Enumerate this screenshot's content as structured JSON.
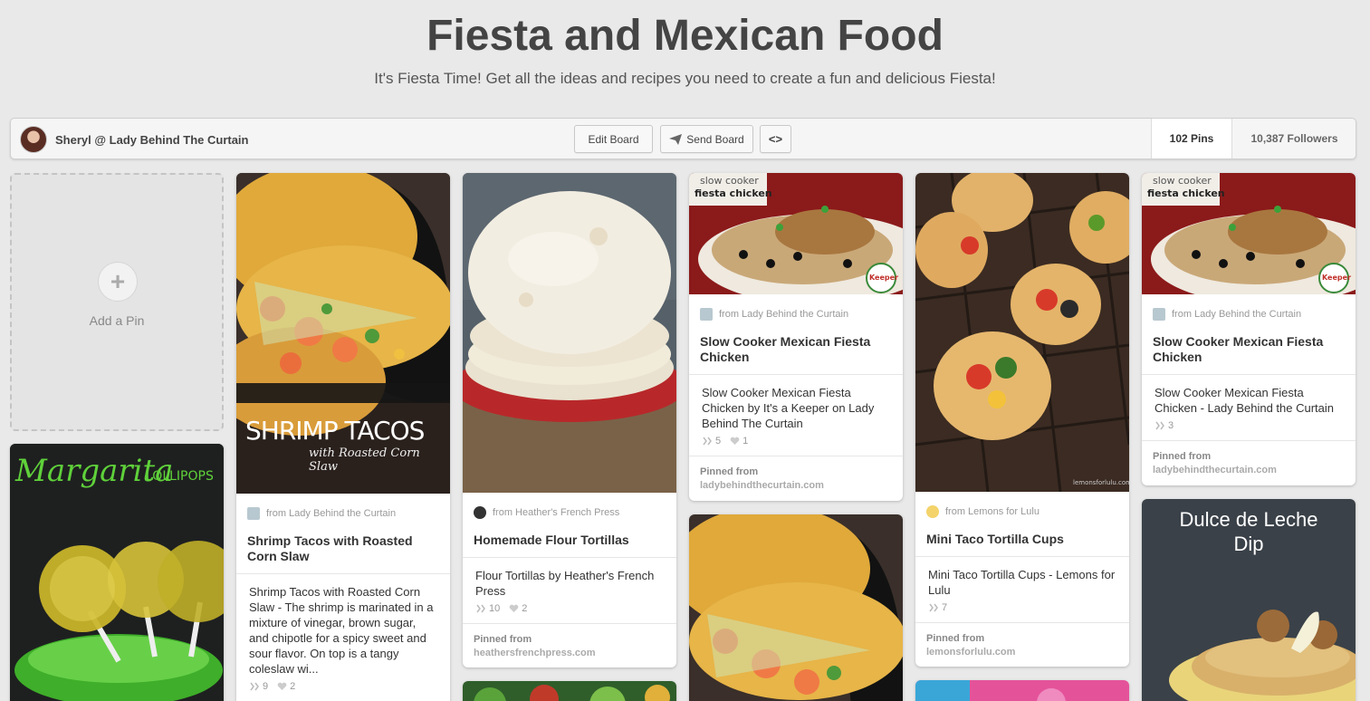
{
  "board": {
    "title": "Fiesta and Mexican Food",
    "description": "It's Fiesta Time! Get all the ideas and recipes you need to create a fun and delicious Fiesta!"
  },
  "toolbar": {
    "owner_name": "Sheryl @ Lady Behind The Curtain",
    "edit_label": "Edit Board",
    "send_label": "Send Board",
    "embed_label": "<>",
    "pins_count": "102 Pins",
    "followers_count": "10,387 Followers"
  },
  "add_pin": {
    "label": "Add a Pin"
  },
  "pinned_from_label": "Pinned from",
  "pins": {
    "shrimp": {
      "overlay_title": "SHRIMP TACOS",
      "overlay_sub": "with Roasted Corn Slaw",
      "source": "from Lady Behind the Curtain",
      "title": "Shrimp Tacos with Roasted Corn Slaw",
      "description": "Shrimp Tacos with Roasted Corn Slaw - The shrimp is marinated in a mixture of vinegar, brown sugar, and chipotle for a spicy sweet and sour flavor. On top is a tangy coleslaw wi...",
      "repins": "9",
      "likes": "2"
    },
    "tortillas": {
      "source": "from Heather's French Press",
      "title": "Homemade Flour Tortillas",
      "description": "Flour Tortillas by Heather's French Press",
      "repins": "10",
      "likes": "2",
      "domain": "heathersfrenchpress.com"
    },
    "chicken1": {
      "overlay_small": "slow cooker",
      "overlay_big": "fiesta chicken",
      "badge": "Keeper",
      "source": "from Lady Behind the Curtain",
      "title": "Slow Cooker Mexican Fiesta Chicken",
      "description": "Slow Cooker Mexican Fiesta Chicken by It's a Keeper on Lady Behind The Curtain",
      "repins": "5",
      "likes": "1",
      "domain": "ladybehindthecurtain.com"
    },
    "cups": {
      "watermark": "lemonsforlulu.com",
      "source": "from Lemons for Lulu",
      "title": "Mini Taco Tortilla Cups",
      "description": "Mini Taco Tortilla Cups - Lemons for Lulu",
      "repins": "7",
      "domain": "lemonsforlulu.com"
    },
    "chicken2": {
      "overlay_small": "slow cooker",
      "overlay_big": "fiesta chicken",
      "badge": "Keeper",
      "source": "from Lady Behind the Curtain",
      "title": "Slow Cooker Mexican Fiesta Chicken",
      "description": "Slow Cooker Mexican Fiesta Chicken - Lady Behind the Curtain",
      "repins": "3",
      "domain": "ladybehindthecurtain.com"
    },
    "margarita": {
      "overlay_title": "Margarita",
      "overlay_sub": "LOLLIPOPS"
    },
    "dulce": {
      "overlay_title_1": "Dulce de Leche",
      "overlay_title_2": "Dip"
    }
  },
  "colors": {
    "background": "#e9e9e9",
    "title_text": "#444444",
    "margarita_green": "#5fd13a",
    "chicken_banner": "#8b1a1a"
  }
}
